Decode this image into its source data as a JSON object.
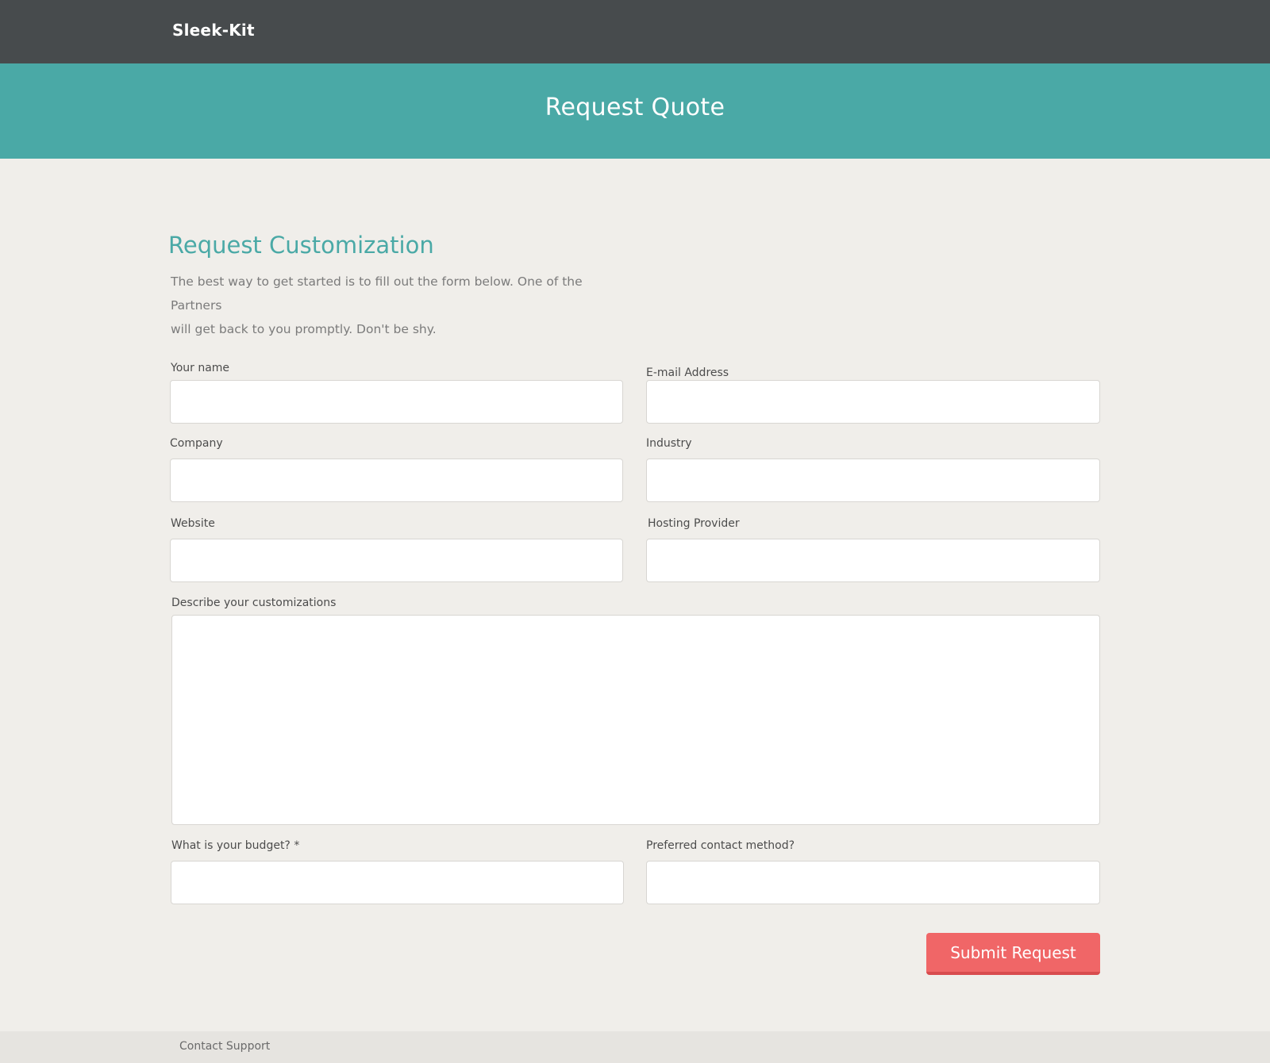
{
  "navbar": {
    "brand": "Sleek-Kit"
  },
  "banner": {
    "title": "Request Quote"
  },
  "main": {
    "section_title": "Request Customization",
    "intro_line1": "The best way to get started is to fill out the form below. One of the Partners",
    "intro_line2": "will get back to you promptly. Don't be shy."
  },
  "form": {
    "name_label": "Your name",
    "name_value": "",
    "email_label": "E-mail Address",
    "email_value": "",
    "company_label": "Company",
    "company_value": "",
    "industry_label": "Industry",
    "industry_value": "",
    "website_label": "Website",
    "website_value": "",
    "hosting_label": "Hosting Provider",
    "hosting_value": "",
    "customizations_label": "Describe your customizations",
    "customizations_value": "",
    "budget_label": "What is your budget? *",
    "budget_value": "",
    "contact_method_label": "Preferred contact method?",
    "contact_method_value": "",
    "submit_label": "Submit Request"
  },
  "footer": {
    "contact_support": "Contact Support"
  },
  "colors": {
    "navbar": "#474b4d",
    "accent_teal": "#4aa9a6",
    "background": "#f0eeea",
    "submit_button": "#f06667",
    "footer": "#e6e4e0"
  }
}
